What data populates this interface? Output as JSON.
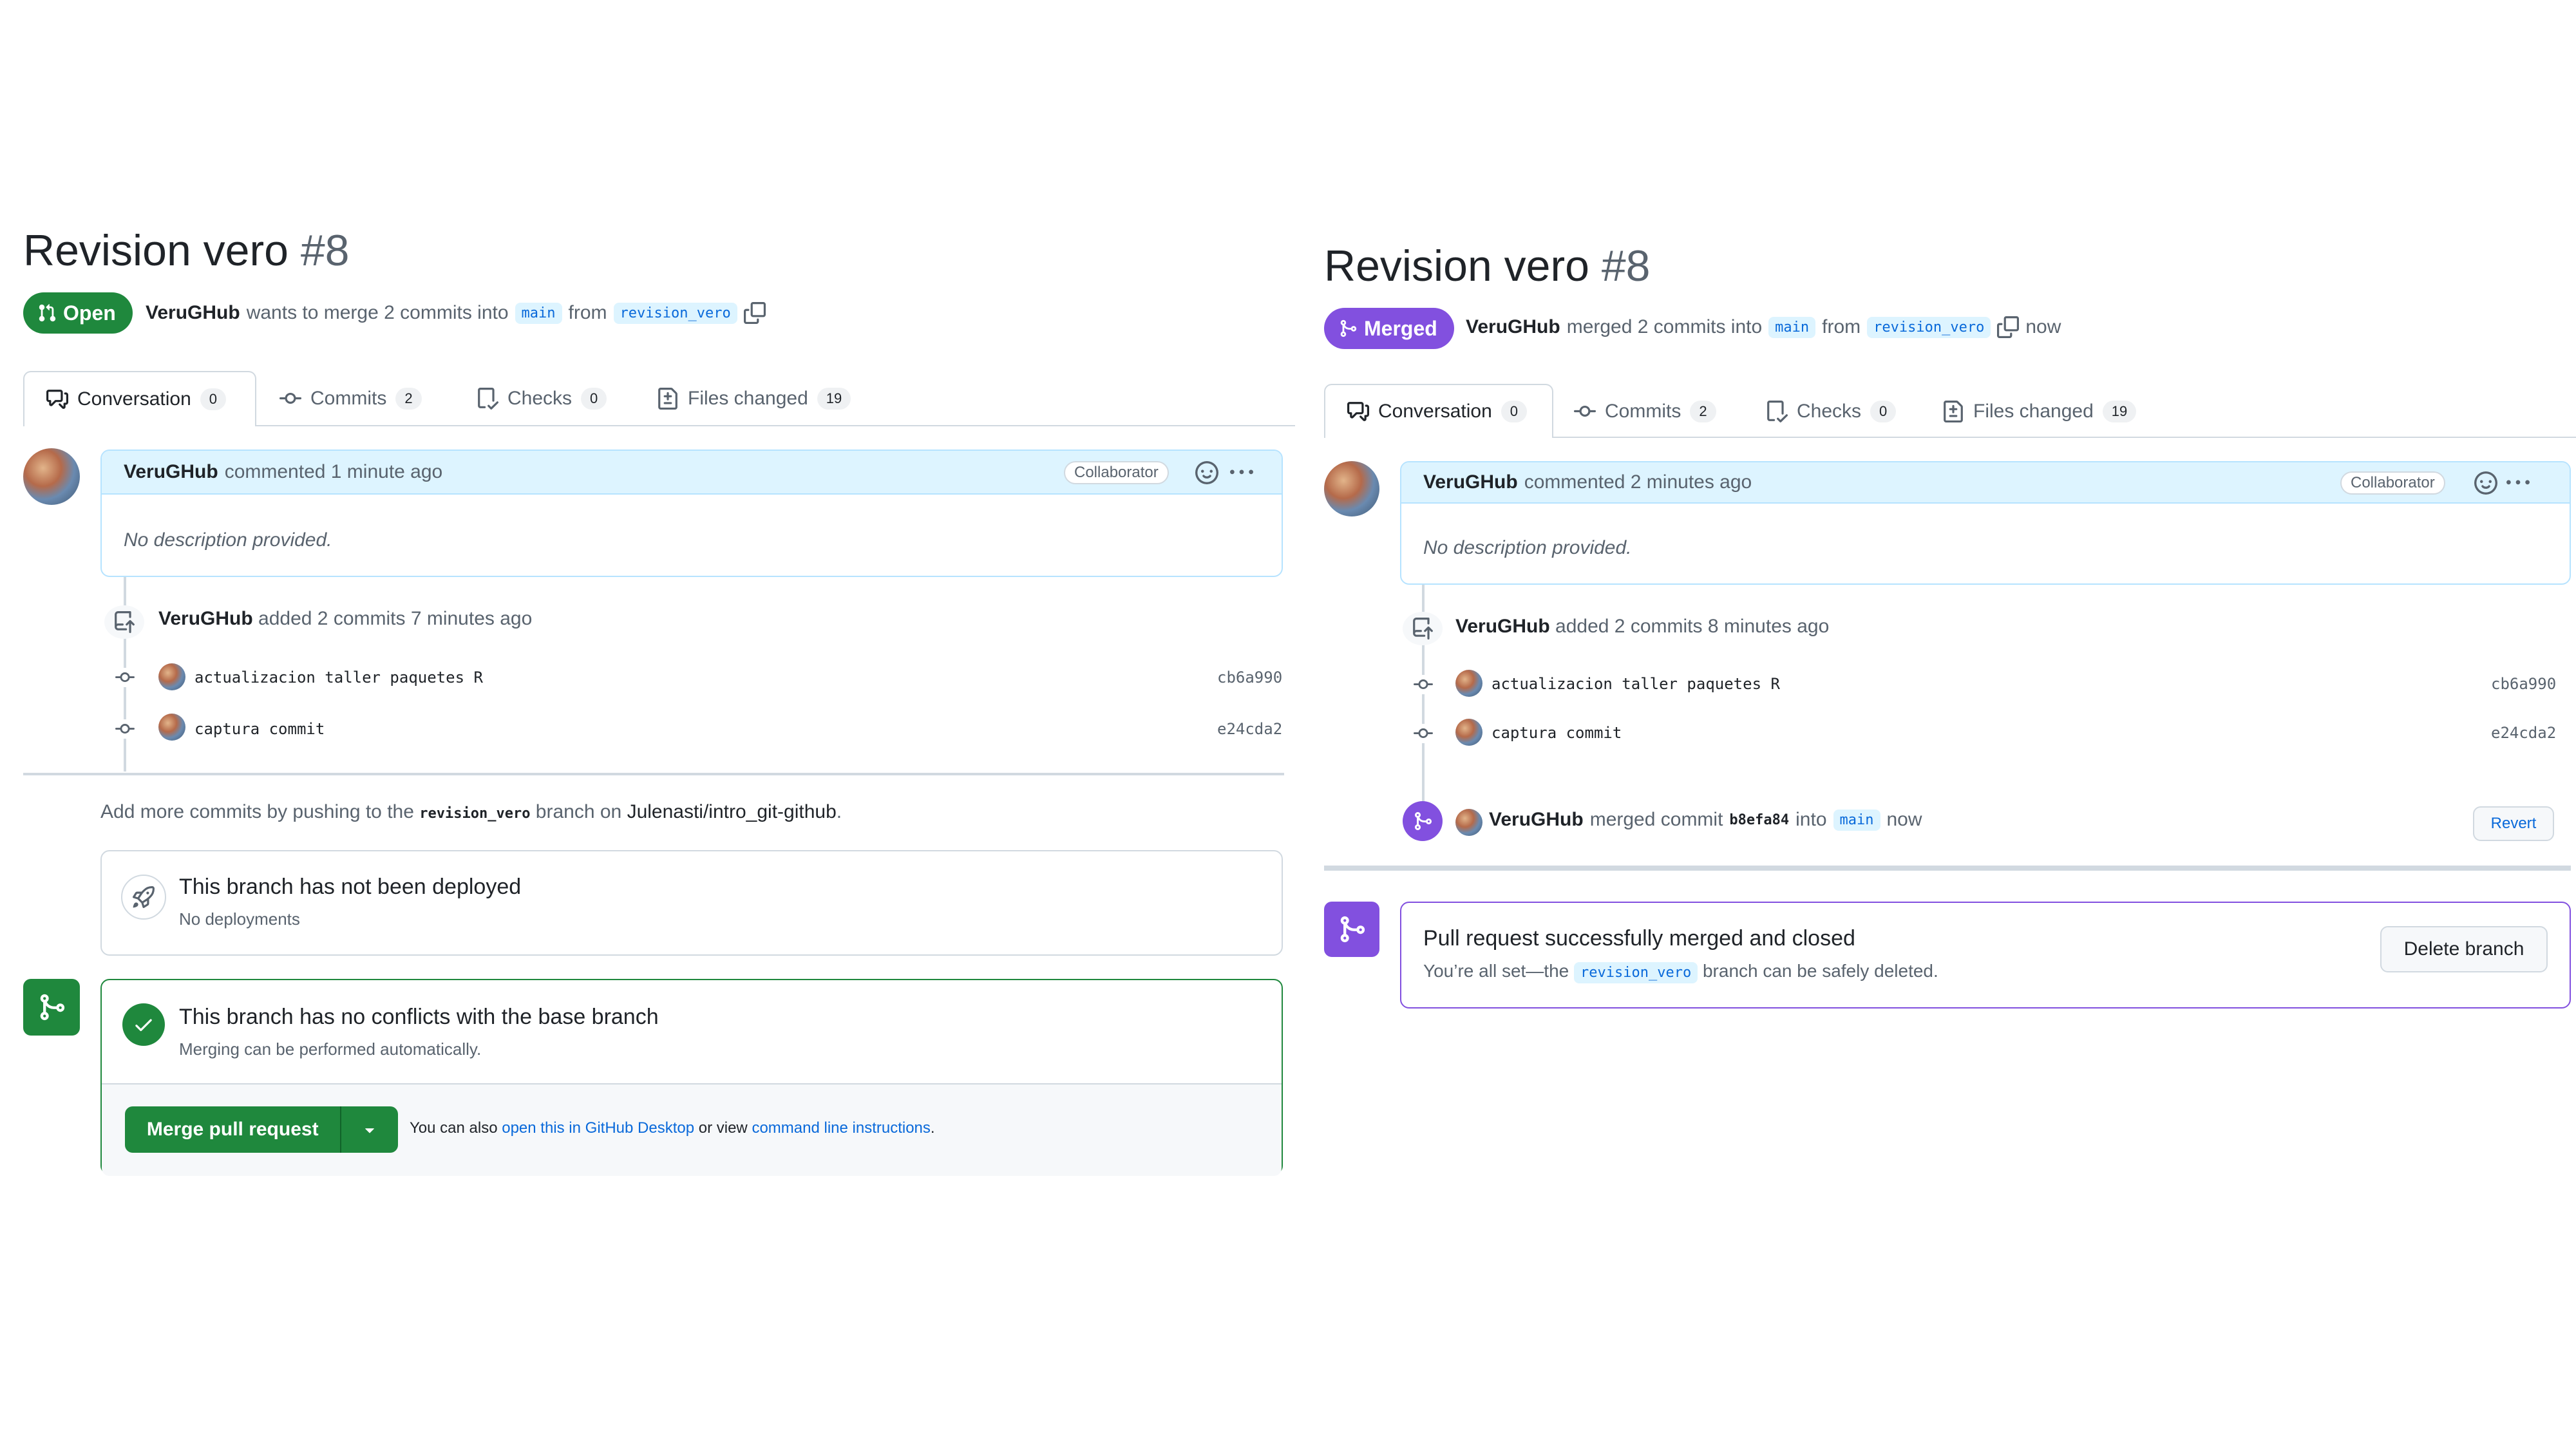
{
  "left": {
    "title": "Revision vero",
    "number": "#8",
    "state_label": "Open",
    "meta": {
      "author": "VeruGHub",
      "text": "wants to merge 2 commits into",
      "base_branch": "main",
      "from": "from",
      "head_branch": "revision_vero"
    },
    "tabs": [
      {
        "label": "Conversation",
        "count": "0"
      },
      {
        "label": "Commits",
        "count": "2"
      },
      {
        "label": "Checks",
        "count": "0"
      },
      {
        "label": "Files changed",
        "count": "19"
      }
    ],
    "comment": {
      "author": "VeruGHub",
      "action": "commented 1 minute ago",
      "badge": "Collaborator",
      "body": "No description provided."
    },
    "commits_event": {
      "author": "VeruGHub",
      "text": "added 2 commits 7 minutes ago"
    },
    "commits": [
      {
        "message": "actualizacion taller paquetes R",
        "sha": "cb6a990"
      },
      {
        "message": "captura commit",
        "sha": "e24cda2"
      }
    ],
    "push_hint": {
      "prefix": "Add more commits by pushing to the",
      "branch": "revision_vero",
      "middle": "branch on",
      "repo": "Julenasti/intro_git-github",
      "suffix": "."
    },
    "deploy": {
      "title": "This branch has not been deployed",
      "subtitle": "No deployments"
    },
    "conflicts": {
      "title": "This branch has no conflicts with the base branch",
      "subtitle": "Merging can be performed automatically."
    },
    "merge": {
      "button": "Merge pull request",
      "also_prefix": "You can also",
      "desktop_link": "open this in GitHub Desktop",
      "or_view": "or view",
      "cli_link": "command line instructions",
      "suffix": "."
    }
  },
  "right": {
    "title": "Revision vero",
    "number": "#8",
    "state_label": "Merged",
    "meta": {
      "author": "VeruGHub",
      "text": "merged 2 commits into",
      "base_branch": "main",
      "from": "from",
      "head_branch": "revision_vero",
      "time": "now"
    },
    "tabs": [
      {
        "label": "Conversation",
        "count": "0"
      },
      {
        "label": "Commits",
        "count": "2"
      },
      {
        "label": "Checks",
        "count": "0"
      },
      {
        "label": "Files changed",
        "count": "19"
      }
    ],
    "comment": {
      "author": "VeruGHub",
      "action": "commented 2 minutes ago",
      "badge": "Collaborator",
      "body": "No description provided."
    },
    "commits_event": {
      "author": "VeruGHub",
      "text": "added 2 commits 8 minutes ago"
    },
    "commits": [
      {
        "message": "actualizacion taller paquetes R",
        "sha": "cb6a990"
      },
      {
        "message": "captura commit",
        "sha": "e24cda2"
      }
    ],
    "merge_event": {
      "author": "VeruGHub",
      "text": "merged commit",
      "sha": "b8efa84",
      "into": "into",
      "branch": "main",
      "time": "now",
      "revert": "Revert"
    },
    "merged_box": {
      "title": "Pull request successfully merged and closed",
      "prefix": "You’re all set—the",
      "branch": "revision_vero",
      "suffix": "branch can be safely deleted.",
      "delete_button": "Delete branch"
    }
  },
  "colors": {
    "open_green": "#1f883d",
    "merged_purple": "#8250df",
    "link_blue": "#0969da",
    "border": "#d1d9e0"
  }
}
